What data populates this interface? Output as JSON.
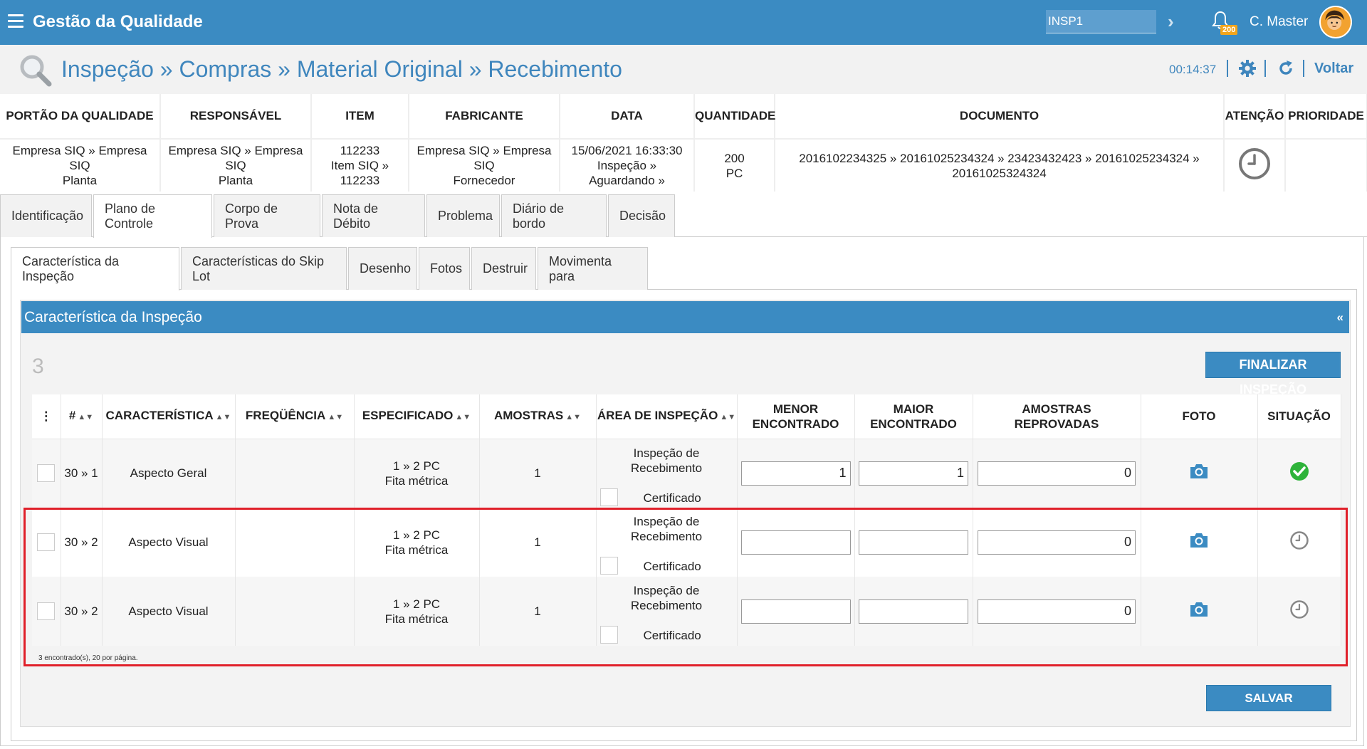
{
  "app": {
    "title": "Gestão da Qualidade"
  },
  "topbar": {
    "search_value": "INSP1",
    "notification_count": "200",
    "user_name": "C. Master"
  },
  "header": {
    "breadcrumb": "Inspeção » Compras » Material Original » Recebimento",
    "timer": "00:14:37",
    "back_label": "Voltar"
  },
  "info": {
    "headers": [
      "PORTÃO DA QUALIDADE",
      "RESPONSÁVEL",
      "ITEM",
      "FABRICANTE",
      "DATA",
      "QUANTIDADE",
      "DOCUMENTO",
      "ATENÇÃO",
      "PRIORIDADE"
    ],
    "values": {
      "portao": [
        "Empresa SIQ » Empresa",
        "SIQ",
        "Planta"
      ],
      "responsavel": [
        "Empresa SIQ » Empresa",
        "SIQ",
        "Planta"
      ],
      "item": [
        "112233",
        "Item SIQ »",
        "112233"
      ],
      "fabricante": [
        "Empresa SIQ » Empresa",
        "SIQ",
        "Fornecedor"
      ],
      "data": [
        "15/06/2021 16:33:30",
        "Inspeção »",
        "Aguardando »"
      ],
      "quantidade": [
        "200",
        "PC"
      ],
      "documento": [
        "2016102234325 » 20161025234324 » 23423432423 » 20161025234324 »",
        "20161025324324"
      ],
      "prioridade": ""
    }
  },
  "main_tabs": [
    "Identificação",
    "Plano de Controle",
    "Corpo de Prova",
    "Nota de Débito",
    "Problema",
    "Diário de bordo",
    "Decisão"
  ],
  "sub_tabs": [
    "Característica da Inspeção",
    "Características do Skip Lot",
    "Desenho",
    "Fotos",
    "Destruir",
    "Movimenta para"
  ],
  "section": {
    "title": "Característica da Inspeção",
    "collapse_icon": "«",
    "count": "3",
    "finalize_label": "FINALIZAR INSPEÇÃO",
    "save_label": "SALVAR",
    "footer_note": "3 encontrado(s), 20 por página."
  },
  "table": {
    "columns": {
      "menu": "⋮",
      "num": "#",
      "caracteristica": "CARACTERÍSTICA",
      "frequencia": "FREQÜÊNCIA",
      "especificado": "ESPECIFICADO",
      "amostras": "AMOSTRAS",
      "area": "ÁREA DE INSPEÇÃO",
      "menor_1": "MENOR",
      "menor_2": "ENCONTRADO",
      "maior_1": "MAIOR",
      "maior_2": "ENCONTRADO",
      "reprovadas_1": "AMOSTRAS",
      "reprovadas_2": "REPROVADAS",
      "foto": "FOTO",
      "situacao": "SITUAÇÃO"
    },
    "rows": [
      {
        "num": "30 » 1",
        "caracteristica": "Aspecto Geral",
        "frequencia": "",
        "esp_1": "1 » 2 PC",
        "esp_2": "Fita métrica",
        "amostras": "1",
        "area_1": "Inspeção de",
        "area_2": "Recebimento",
        "area_cert": "Certificado",
        "menor": "1",
        "maior": "1",
        "reprovadas": "0",
        "situacao": "approved"
      },
      {
        "num": "30 » 2",
        "caracteristica": "Aspecto Visual",
        "frequencia": "",
        "esp_1": "1 » 2 PC",
        "esp_2": "Fita métrica",
        "amostras": "1",
        "area_1": "Inspeção de",
        "area_2": "Recebimento",
        "area_cert": "Certificado",
        "menor": "",
        "maior": "",
        "reprovadas": "0",
        "situacao": "pending"
      },
      {
        "num": "30 » 2",
        "caracteristica": "Aspecto Visual",
        "frequencia": "",
        "esp_1": "1 » 2 PC",
        "esp_2": "Fita métrica",
        "amostras": "1",
        "area_1": "Inspeção de",
        "area_2": "Recebimento",
        "area_cert": "Certificado",
        "menor": "",
        "maior": "",
        "reprovadas": "0",
        "situacao": "pending"
      }
    ]
  },
  "colors": {
    "primary": "#3b8bc2",
    "link": "#3f86bd",
    "badge": "#f3a51b",
    "approved": "#2eb33a",
    "highlight": "#e0202a"
  },
  "icons": [
    "menu-icon",
    "chevron-right-icon",
    "bell-icon",
    "search-icon",
    "gear-icon",
    "refresh-icon",
    "clock-icon",
    "camera-icon",
    "check-circle-icon"
  ]
}
